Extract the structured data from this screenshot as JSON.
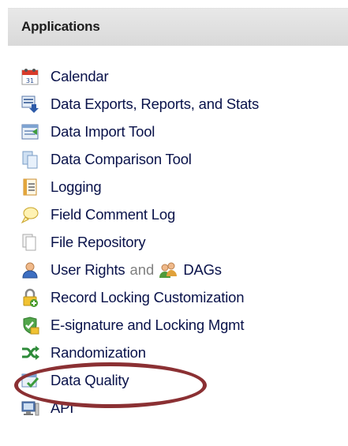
{
  "header": {
    "title": "Applications"
  },
  "items": [
    {
      "label": "Calendar",
      "icon": "calendar-icon"
    },
    {
      "label": "Data Exports, Reports, and Stats",
      "icon": "data-export-icon"
    },
    {
      "label": "Data Import Tool",
      "icon": "data-import-icon"
    },
    {
      "label": "Data Comparison Tool",
      "icon": "data-comparison-icon"
    },
    {
      "label": "Logging",
      "icon": "logging-icon"
    },
    {
      "label": "Field Comment Log",
      "icon": "field-comment-icon"
    },
    {
      "label": "File Repository",
      "icon": "file-repository-icon"
    },
    {
      "label": "User Rights",
      "connector": "and",
      "label2": "DAGs",
      "icon": "user-icon",
      "icon2": "group-icon"
    },
    {
      "label": "Record Locking Customization",
      "icon": "lock-icon"
    },
    {
      "label": "E-signature and Locking Mgmt",
      "icon": "esignature-icon"
    },
    {
      "label": "Randomization",
      "icon": "randomization-icon",
      "highlighted": true
    },
    {
      "label": "Data Quality",
      "icon": "data-quality-icon"
    },
    {
      "label": "API",
      "icon": "api-icon"
    }
  ],
  "colors": {
    "link": "#09124a",
    "header_bg": "#dedede",
    "highlight": "#8b3033"
  }
}
